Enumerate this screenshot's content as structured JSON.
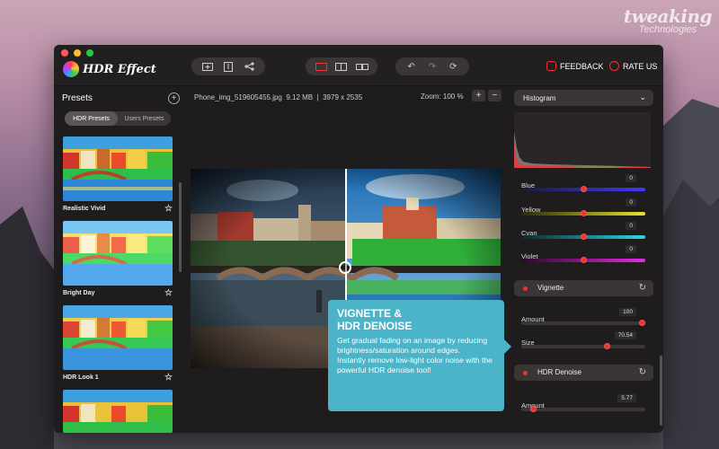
{
  "watermark": {
    "line1": "tweaking",
    "line2": "Technologies"
  },
  "app": {
    "name": "HDR Effect"
  },
  "toolbar": {
    "feedback": "FEEDBACK",
    "rate_us": "RATE US"
  },
  "presets": {
    "title": "Presets",
    "tabs": [
      "HDR Presets",
      "Users Presets"
    ],
    "items": [
      {
        "label": "Realistic Vivid"
      },
      {
        "label": "Bright Day"
      },
      {
        "label": "HDR Look 1"
      },
      {
        "label": ""
      }
    ]
  },
  "file": {
    "name": "Phone_img_519605455.jpg",
    "size": "9.12 MB",
    "separator": "|",
    "dims": "3979 x 2535"
  },
  "zoom": {
    "label": "Zoom: 100 %",
    "plus": "+",
    "minus": "−"
  },
  "callout": {
    "title": "VIGNETTE &\nHDR DENOISE",
    "body": "Get gradual fading on an image by reducing brightness/saturation around edges.\nInstantly remove low-light color noise with the powerful HDR denoise tool!"
  },
  "panel": {
    "histogram_label": "Histogram",
    "colors": [
      {
        "label": "Blue",
        "value": "0",
        "level": 0.5
      },
      {
        "label": "Yellow",
        "value": "0",
        "level": 0.5
      },
      {
        "label": "Cyan",
        "value": "0",
        "level": 0.5
      },
      {
        "label": "Violet",
        "value": "0",
        "level": 0.5
      }
    ],
    "vignette": {
      "title": "Vignette",
      "amount_label": "Amount",
      "amount": "100",
      "amount_level": 1.0,
      "size_label": "Size",
      "size": "70.54",
      "size_level": 0.7054
    },
    "denoise": {
      "title": "HDR Denoise",
      "amount_label": "Amount",
      "amount": "5.77",
      "amount_level": 0.08
    }
  },
  "colors": {
    "accent": "#e33b3b",
    "callout": "#4bb4c8",
    "window": "#1f1c1d"
  }
}
